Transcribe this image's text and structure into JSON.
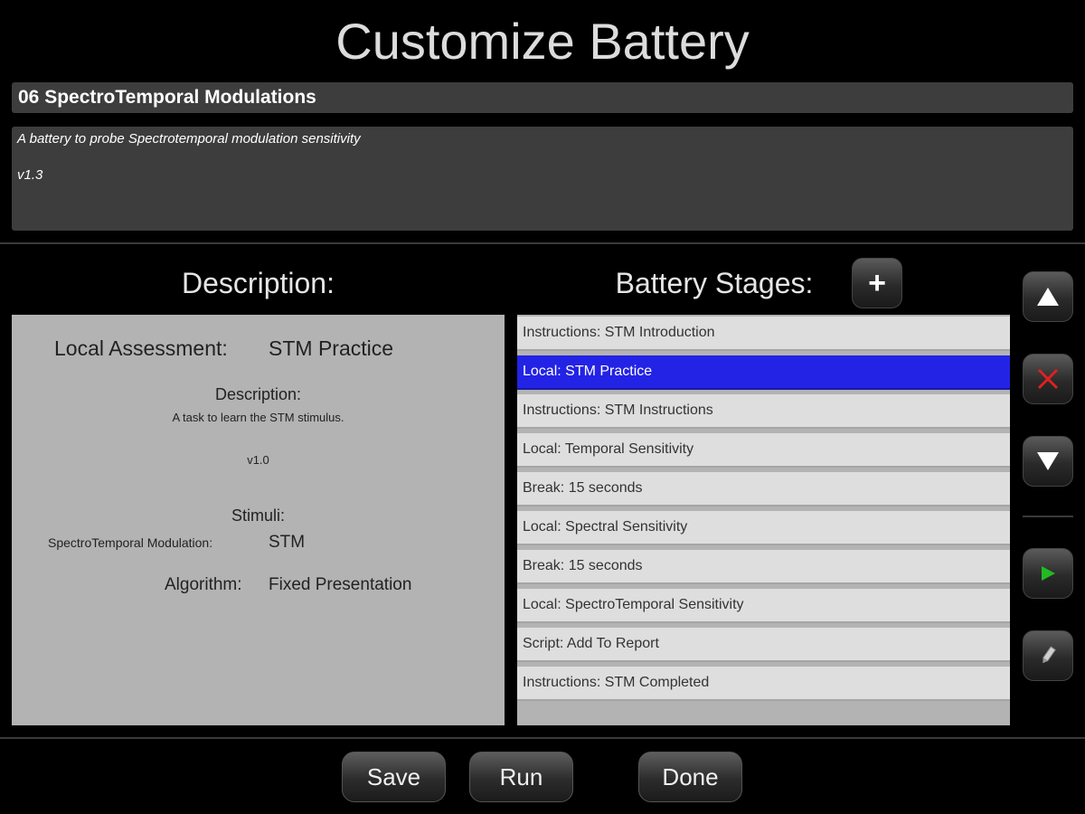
{
  "header": {
    "title": "Customize Battery"
  },
  "battery": {
    "name": "06 SpectroTemporal Modulations",
    "description_line1": "A battery to probe Spectrotemporal modulation sensitivity",
    "description_line2": "v1.3"
  },
  "description_panel": {
    "heading": "Description:",
    "assessment_label": "Local Assessment:",
    "assessment_value": "STM Practice",
    "description_label": "Description:",
    "description_text": "A task to learn the STM stimulus.",
    "version": "v1.0",
    "stimuli_label": "Stimuli:",
    "stimulus_key": "SpectroTemporal Modulation:",
    "stimulus_value": "STM",
    "algorithm_label": "Algorithm:",
    "algorithm_value": "Fixed Presentation"
  },
  "stages_panel": {
    "heading": "Battery Stages:",
    "add_symbol": "+",
    "items": [
      {
        "label": "Instructions: STM Introduction"
      },
      {
        "label": "Local: STM Practice"
      },
      {
        "label": "Instructions: STM Instructions"
      },
      {
        "label": "Local: Temporal Sensitivity"
      },
      {
        "label": "Break: 15 seconds"
      },
      {
        "label": "Local: Spectral Sensitivity"
      },
      {
        "label": "Break: 15 seconds"
      },
      {
        "label": "Local: SpectroTemporal Sensitivity"
      },
      {
        "label": "Script: Add To Report"
      },
      {
        "label": "Instructions: STM Completed"
      }
    ],
    "selected_index": 1
  },
  "side_controls": {
    "icons": [
      "up-triangle-icon",
      "close-x-icon",
      "down-triangle-icon",
      "play-icon",
      "pencil-icon"
    ],
    "delete_color": "#e02020",
    "play_color": "#22bb22"
  },
  "footer": {
    "save_label": "Save",
    "run_label": "Run",
    "done_label": "Done"
  },
  "colors": {
    "selection": "#2323e6",
    "panel_bg": "#b3b3b3",
    "field_bg": "#3d3d3d"
  }
}
